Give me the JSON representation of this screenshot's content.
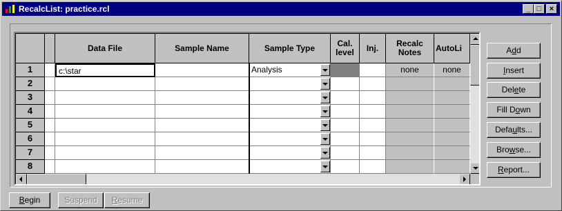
{
  "window": {
    "title": "RecalcList: practice.rcl",
    "minimize_glyph": "_",
    "maximize_glyph": "□",
    "close_glyph": "×"
  },
  "grid": {
    "columns": [
      {
        "key": "data_file",
        "label": "Data File"
      },
      {
        "key": "sample_name",
        "label": "Sample Name"
      },
      {
        "key": "sample_type",
        "label": "Sample Type"
      },
      {
        "key": "cal_level",
        "label": "Cal.\nlevel"
      },
      {
        "key": "inj",
        "label": "Inj."
      },
      {
        "key": "recalc_notes",
        "label": "Recalc\nNotes"
      },
      {
        "key": "autolink",
        "label": "AutoLi"
      }
    ],
    "row_numbers": [
      "1",
      "2",
      "3",
      "4",
      "5",
      "6",
      "7",
      "8"
    ],
    "rows": [
      {
        "data_file": "c:\\star",
        "sample_name": "",
        "sample_type": "Analysis",
        "cal_level": "",
        "inj": "",
        "recalc_notes": "none",
        "autolink": "none"
      },
      {
        "data_file": "",
        "sample_name": "",
        "sample_type": "",
        "cal_level": "",
        "inj": "",
        "recalc_notes": "",
        "autolink": ""
      },
      {
        "data_file": "",
        "sample_name": "",
        "sample_type": "",
        "cal_level": "",
        "inj": "",
        "recalc_notes": "",
        "autolink": ""
      },
      {
        "data_file": "",
        "sample_name": "",
        "sample_type": "",
        "cal_level": "",
        "inj": "",
        "recalc_notes": "",
        "autolink": ""
      },
      {
        "data_file": "",
        "sample_name": "",
        "sample_type": "",
        "cal_level": "",
        "inj": "",
        "recalc_notes": "",
        "autolink": ""
      },
      {
        "data_file": "",
        "sample_name": "",
        "sample_type": "",
        "cal_level": "",
        "inj": "",
        "recalc_notes": "",
        "autolink": ""
      },
      {
        "data_file": "",
        "sample_name": "",
        "sample_type": "",
        "cal_level": "",
        "inj": "",
        "recalc_notes": "",
        "autolink": ""
      },
      {
        "data_file": "",
        "sample_name": "",
        "sample_type": "",
        "cal_level": "",
        "inj": "",
        "recalc_notes": "",
        "autolink": ""
      }
    ]
  },
  "side_buttons": {
    "add": {
      "pre": "A",
      "u": "d",
      "post": "d"
    },
    "insert": {
      "pre": "",
      "u": "I",
      "post": "nsert"
    },
    "delete": {
      "pre": "Del",
      "u": "e",
      "post": "te"
    },
    "fill_down": {
      "pre": "Fill D",
      "u": "o",
      "post": "wn"
    },
    "defaults": {
      "pre": "Defa",
      "u": "u",
      "post": "lts..."
    },
    "browse": {
      "pre": "Bro",
      "u": "w",
      "post": "se..."
    },
    "report": {
      "pre": "",
      "u": "R",
      "post": "eport..."
    }
  },
  "bottom_buttons": {
    "begin": {
      "pre": "",
      "u": "B",
      "post": "egin"
    },
    "suspend": {
      "pre": "Suspend",
      "u": "",
      "post": ""
    },
    "resume": {
      "pre": "",
      "u": "R",
      "post": "esume"
    }
  },
  "colors": {
    "title_bar": "#000080",
    "face": "#c0c0c0",
    "highlight_cell": "#808080"
  }
}
